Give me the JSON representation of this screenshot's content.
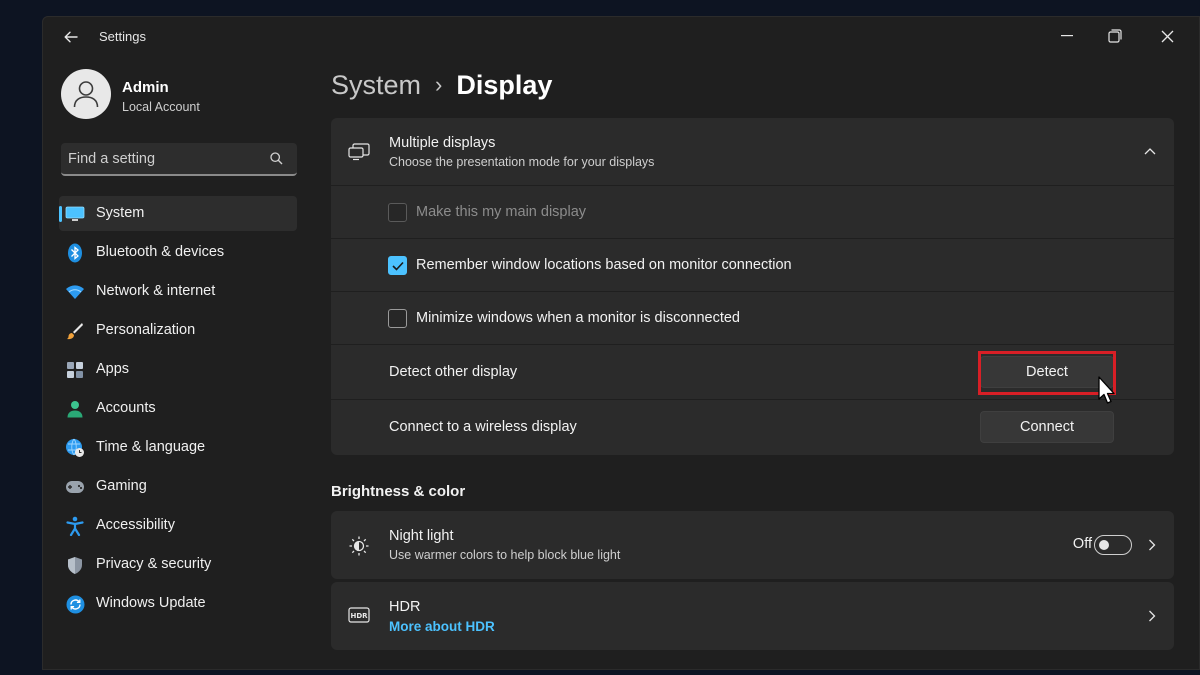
{
  "window": {
    "title": "Settings"
  },
  "profile": {
    "name": "Admin",
    "account_type": "Local Account"
  },
  "search": {
    "placeholder": "Find a setting"
  },
  "sidebar": {
    "items": [
      {
        "label": "System",
        "icon": "monitor-icon",
        "active": true
      },
      {
        "label": "Bluetooth & devices",
        "icon": "bluetooth-icon"
      },
      {
        "label": "Network & internet",
        "icon": "wifi-icon"
      },
      {
        "label": "Personalization",
        "icon": "brush-icon"
      },
      {
        "label": "Apps",
        "icon": "apps-icon"
      },
      {
        "label": "Accounts",
        "icon": "person-icon"
      },
      {
        "label": "Time & language",
        "icon": "globe-clock-icon"
      },
      {
        "label": "Gaming",
        "icon": "gamepad-icon"
      },
      {
        "label": "Accessibility",
        "icon": "accessibility-icon"
      },
      {
        "label": "Privacy & security",
        "icon": "shield-icon"
      },
      {
        "label": "Windows Update",
        "icon": "update-icon"
      }
    ]
  },
  "breadcrumb": {
    "parent": "System",
    "separator": "›",
    "current": "Display"
  },
  "multiple_displays": {
    "title": "Multiple displays",
    "subtitle": "Choose the presentation mode for your displays",
    "main_display": {
      "label": "Make this my main display",
      "checked": false,
      "disabled": true
    },
    "remember_locations": {
      "label": "Remember window locations based on monitor connection",
      "checked": true
    },
    "minimize_windows": {
      "label": "Minimize windows when a monitor is disconnected",
      "checked": false
    },
    "detect": {
      "label": "Detect other display",
      "button": "Detect"
    },
    "connect": {
      "label": "Connect to a wireless display",
      "button": "Connect"
    }
  },
  "brightness_color": {
    "section_title": "Brightness & color",
    "night_light": {
      "title": "Night light",
      "subtitle": "Use warmer colors to help block blue light",
      "state": "Off"
    },
    "hdr": {
      "title": "HDR",
      "link": "More about HDR"
    }
  },
  "colors": {
    "accent": "#4cc2ff",
    "highlight_box": "#d81f26"
  }
}
